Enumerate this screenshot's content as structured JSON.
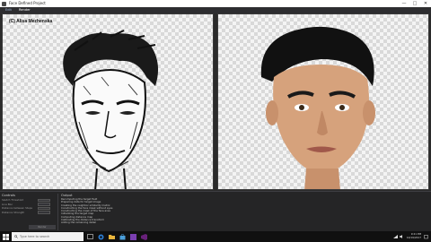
{
  "window": {
    "title": "Face Defined Project",
    "controls": {
      "minimize": "—",
      "maximize": "□",
      "close": "✕"
    }
  },
  "menu": {
    "items": [
      "Edit",
      "Render"
    ],
    "active": "Render"
  },
  "left_panel": {
    "watermark": "(C) Alisa Mezhenska",
    "icon": "line-art-portrait"
  },
  "right_panel": {
    "icon": "photo-portrait"
  },
  "controls": {
    "header": "Controls",
    "rows": [
      {
        "label": "Sketch Threshold",
        "value": ""
      },
      {
        "label": "Line Blur",
        "value": ""
      },
      {
        "label": "Distance between Steps",
        "value": ""
      },
      {
        "label": "Distance Strength",
        "value": ""
      }
    ],
    "button": "Render"
  },
  "output": {
    "header": "Output",
    "lines": [
      "Recomputing the target field",
      "Preparing data for target image",
      "Creating the neighbor similarity matrix",
      "Constructing the face mask without eyes",
      "Constructing the mask of the face area",
      "Initializing the target map",
      "Computing distance map",
      "Calibrating the distance transform",
      "Adding the remaining detail"
    ]
  },
  "taskbar": {
    "search_placeholder": "Type here to search",
    "time": "9:21 PM",
    "date": "10/19/2017"
  },
  "colors": {
    "accent": "#4a9eda",
    "panel_bg": "#2b2b2b",
    "taskbar": "#101010"
  }
}
